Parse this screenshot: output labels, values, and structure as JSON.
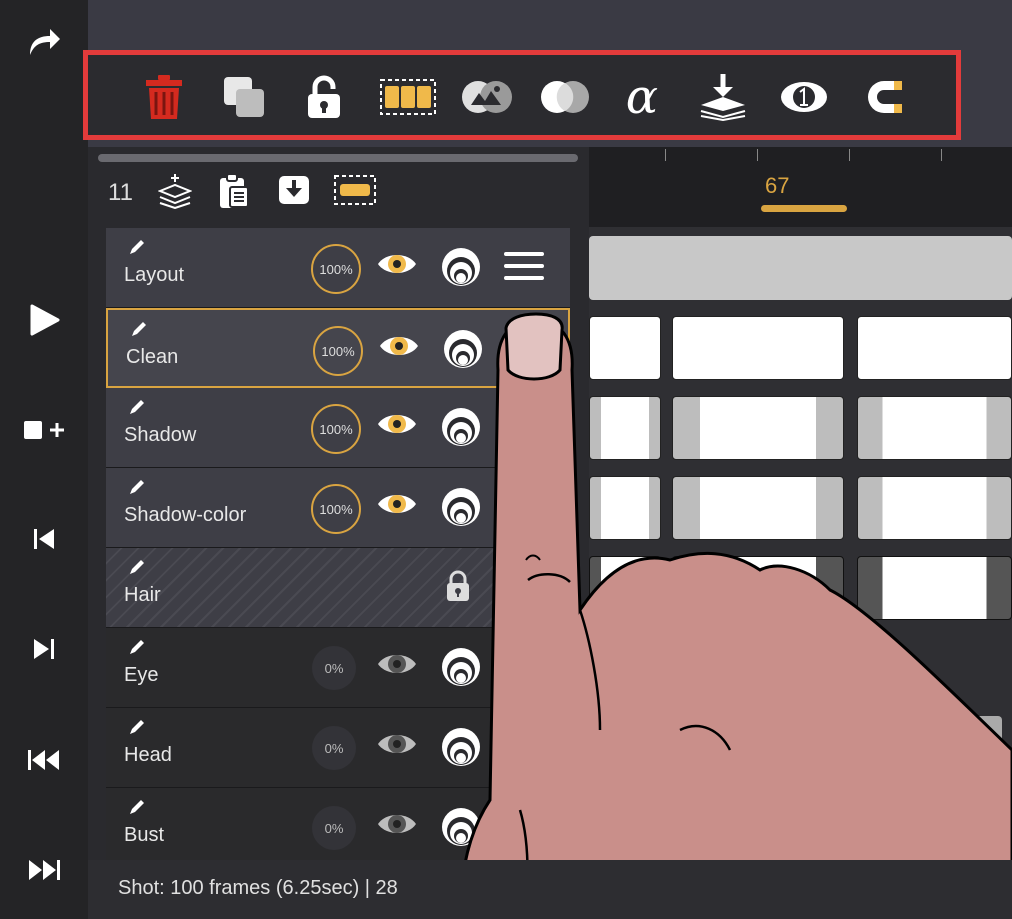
{
  "left_bar": {
    "items": [
      "redo-icon",
      "play-icon",
      "add-frame-icon",
      "prev-keyframe-icon",
      "next-keyframe-icon",
      "rewind-icon",
      "fast-forward-icon"
    ]
  },
  "toolbar": {
    "items": [
      "delete-icon",
      "duplicate-icon",
      "lock-open-icon",
      "select-frames-icon",
      "blend-mode-icon",
      "overlay-icon",
      "alpha-icon",
      "merge-down-icon",
      "opacity-one-icon",
      "magnet-icon"
    ],
    "alpha_glyph": "α"
  },
  "panel_header": {
    "layer_count": "11"
  },
  "timeline": {
    "current_frame": "67",
    "accent": "#d9a441"
  },
  "layers": [
    {
      "name": "Layout",
      "opacity": "100%"
    },
    {
      "name": "Clean",
      "opacity": "100%"
    },
    {
      "name": "Shadow",
      "opacity": "100%"
    },
    {
      "name": "Shadow-color",
      "opacity": "100%"
    },
    {
      "name": "Hair",
      "opacity": ""
    },
    {
      "name": "Eye",
      "opacity": "0%"
    },
    {
      "name": "Head",
      "opacity": "0%"
    },
    {
      "name": "Bust",
      "opacity": "0%"
    }
  ],
  "status": {
    "text": "Shot: 100 frames (6.25sec) | 28"
  },
  "colors": {
    "highlight_border": "#e33b3b",
    "delete_red": "#d42a1f",
    "accent_orange": "#d9a441"
  }
}
